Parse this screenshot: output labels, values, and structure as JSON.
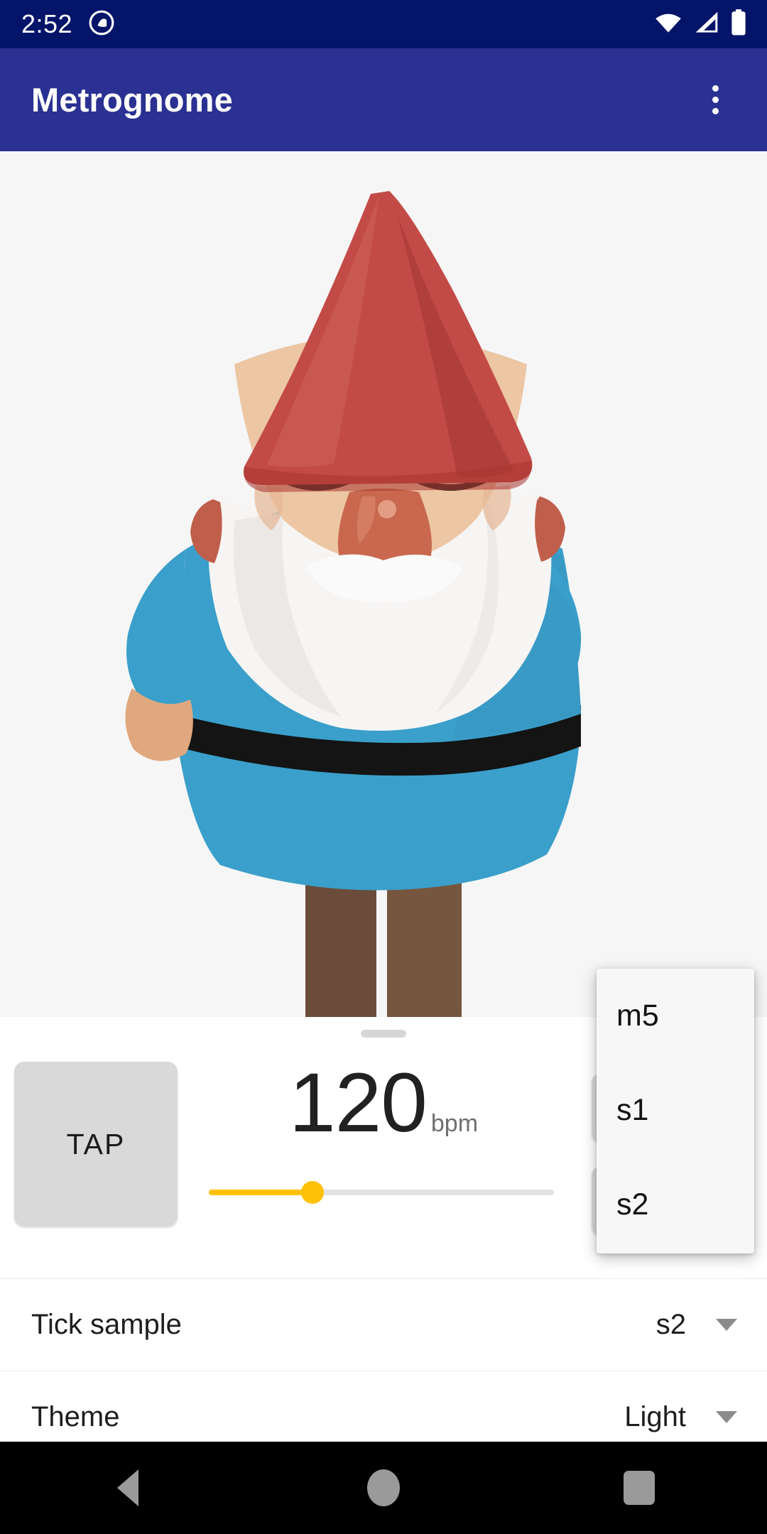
{
  "status_bar": {
    "time": "2:52",
    "icons": [
      "android-q-icon",
      "wifi-icon",
      "cellular-signal-icon",
      "battery-icon"
    ]
  },
  "app_bar": {
    "title": "Metrognome",
    "overflow_icon": "more-vert-icon",
    "background_color": "#2a3192"
  },
  "main": {
    "gnome_illustration": "gnome-illustration",
    "hat_color": "#c14a46",
    "tunic_color": "#3a9fca",
    "belt_color": "#141414",
    "skin_color": "#e8c0a0",
    "beard_color": "#f5f3f1"
  },
  "controls": {
    "tap_label": "TAP",
    "bpm_value": "120",
    "bpm_unit": "bpm",
    "slider_percent": 30,
    "slider_accent_color": "#ffc107",
    "slider_track_color": "#e2e2e2",
    "stepper_increase": "increase-bpm-button",
    "stepper_decrease": "decrease-bpm-button",
    "drag_handle": "sheet-drag-handle"
  },
  "settings": [
    {
      "label": "Tick sample",
      "value": "s2",
      "caret": "chevron-down-icon"
    },
    {
      "label": "Theme",
      "value": "Light",
      "caret": "chevron-down-icon"
    }
  ],
  "dropdown": {
    "open": true,
    "items": [
      {
        "label": "m5"
      },
      {
        "label": "s1"
      },
      {
        "label": "s2"
      }
    ]
  },
  "nav_bar": {
    "back": "back-triangle-icon",
    "home": "home-circle-icon",
    "recents": "recents-square-icon"
  }
}
